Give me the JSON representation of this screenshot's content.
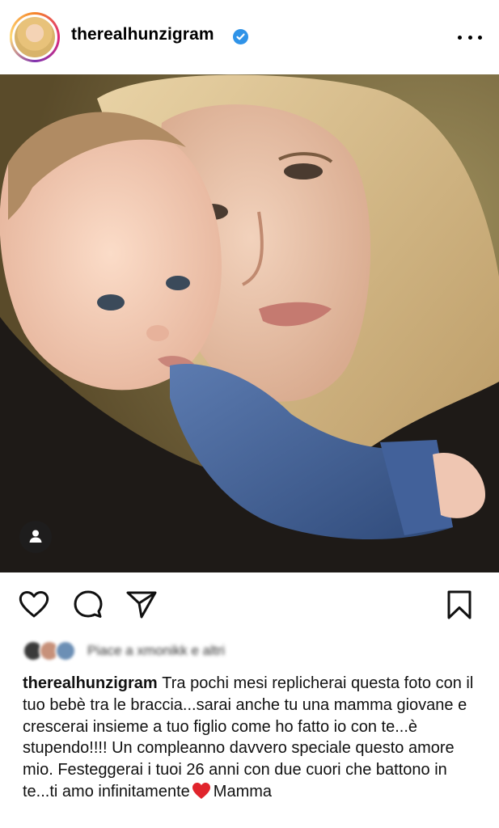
{
  "post": {
    "username": "therealhunzigram",
    "verified": true,
    "more_icon": "more-horizontal-icon"
  },
  "photo": {
    "tag_icon": "user-tag-icon"
  },
  "actions": {
    "like_icon": "heart-icon",
    "comment_icon": "comment-icon",
    "share_icon": "send-icon",
    "save_icon": "bookmark-icon"
  },
  "likes": {
    "text": "Piace a xmonikk e altri"
  },
  "caption": {
    "username": "therealhunzigram",
    "text": "Tra pochi mesi replicherai questa foto con il tuo bebè tra le braccia...sarai anche tu una mamma giovane e crescerai insieme a tuo figlio come ho fatto io con te...è stupendo!!!! Un compleanno davvero speciale questo amore mio. Festeggerai i tuoi 26 anni con due cuori che battono in te...ti amo infinitamente",
    "emoji": "❤️",
    "signature": "Mamma"
  },
  "colors": {
    "verified_blue": "#2f93e8",
    "emoji_red": "#e0242c"
  }
}
